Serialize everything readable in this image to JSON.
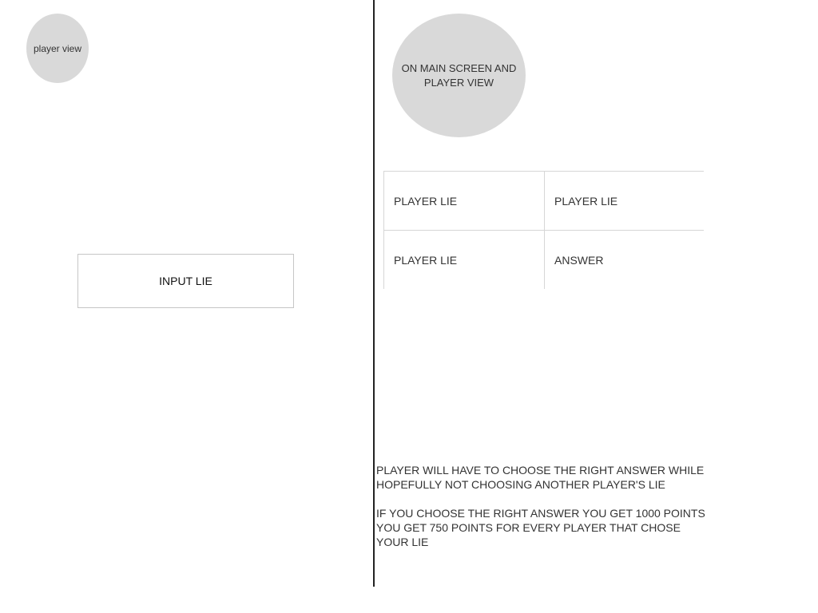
{
  "left_panel": {
    "player_view_label": "player view",
    "input_lie_label": "INPUT LIE"
  },
  "right_panel": {
    "main_screen_label": "ON MAIN SCREEN AND PLAYER VIEW",
    "grid": {
      "cells": [
        "PLAYER LIE",
        "PLAYER LIE",
        "PLAYER LIE",
        "ANSWER"
      ]
    },
    "instructions": {
      "paragraph1": "PLAYER WILL HAVE TO CHOOSE THE RIGHT ANSWER WHILE HOPEFULLY NOT CHOOSING ANOTHER PLAYER'S LIE",
      "paragraph2": "IF YOU CHOOSE THE RIGHT ANSWER YOU GET 1000 POINTS YOU GET 750 POINTS FOR EVERY PLAYER THAT CHOSE YOUR LIE"
    }
  },
  "colors": {
    "ellipse_fill": "#d9d9d9",
    "divider": "#222222",
    "border": "#d6d6d6"
  }
}
